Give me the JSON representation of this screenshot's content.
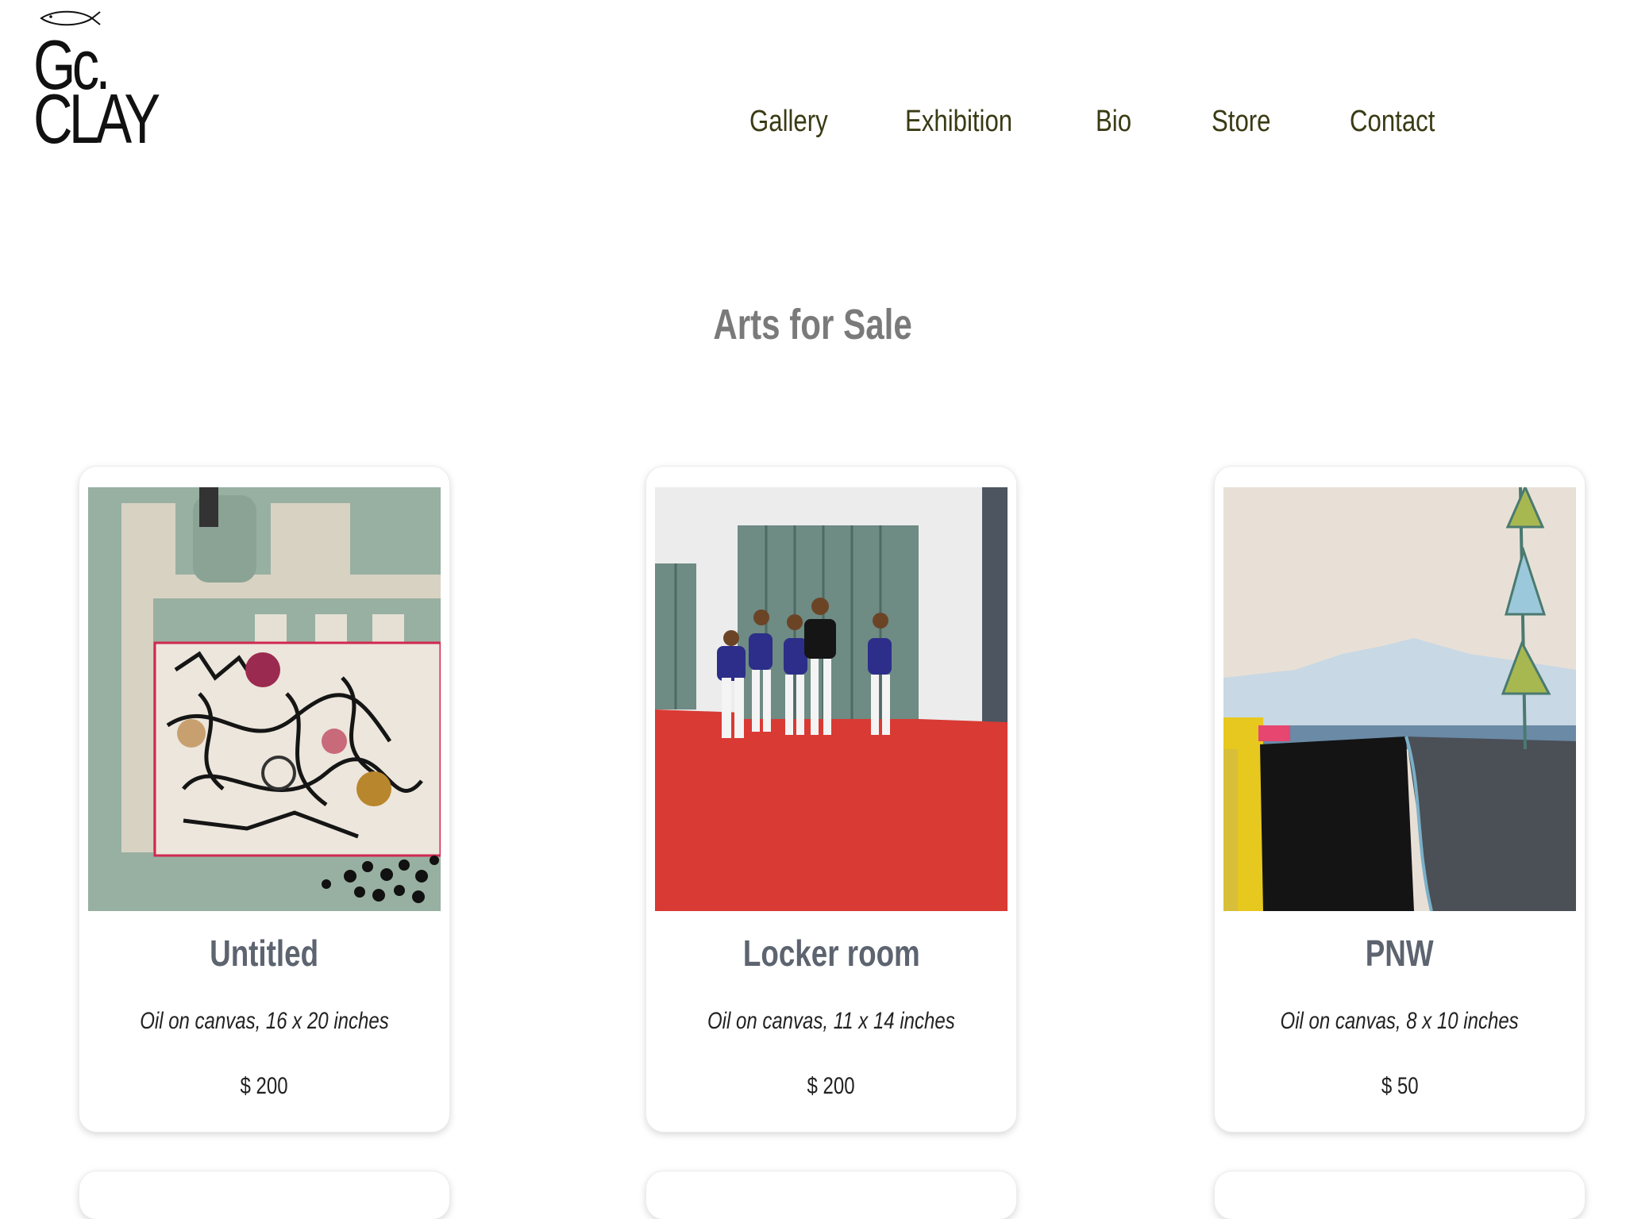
{
  "logo": {
    "line1": "Gc.",
    "line2": "CLAY",
    "icon": "fish-icon"
  },
  "nav": {
    "items": [
      {
        "label": "Gallery"
      },
      {
        "label": "Exhibition"
      },
      {
        "label": "Bio"
      },
      {
        "label": "Store"
      },
      {
        "label": "Contact"
      }
    ]
  },
  "page": {
    "title": "Arts for Sale"
  },
  "products": [
    {
      "title": "Untitled",
      "description": "Oil on canvas, 16 x 20 inches",
      "price": "$ 200",
      "image": "abstract-painting"
    },
    {
      "title": "Locker room",
      "description": "Oil on canvas, 11 x 14 inches",
      "price": "$ 200",
      "image": "dancers-locker-room-painting"
    },
    {
      "title": "PNW",
      "description": "Oil on canvas, 8 x 10 inches",
      "price": "$ 50",
      "image": "landscape-painting"
    }
  ],
  "colors": {
    "nav_text": "#3a3a14",
    "title_text": "#7a7a7a",
    "card_title": "#5d6470"
  }
}
